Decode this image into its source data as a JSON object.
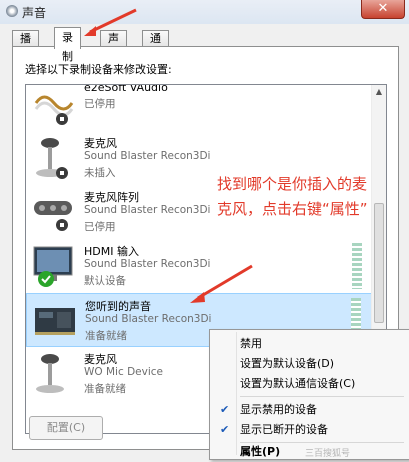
{
  "window": {
    "title": "声音",
    "close_symbol": "✕"
  },
  "tabs": [
    {
      "label": "播放",
      "active": false
    },
    {
      "label": "录制",
      "active": true
    },
    {
      "label": "声音",
      "active": false
    },
    {
      "label": "通信",
      "active": false
    }
  ],
  "panel": {
    "instruction": "选择以下录制设备来修改设置:"
  },
  "devices": [
    {
      "name": "e2eSoft VAudio",
      "model": "",
      "status": "已停用",
      "icon": "cable-icon"
    },
    {
      "name": "麦克风",
      "model": "Sound Blaster Recon3Di",
      "status": "未插入",
      "icon": "microphone-icon"
    },
    {
      "name": "麦克风阵列",
      "model": "Sound Blaster Recon3Di",
      "status": "已停用",
      "icon": "mic-array-icon"
    },
    {
      "name": "HDMI 输入",
      "model": "Sound Blaster Recon3Di",
      "status": "默认设备",
      "icon": "monitor-icon"
    },
    {
      "name": "您听到的声音",
      "model": "Sound Blaster Recon3Di",
      "status": "准备就绪",
      "icon": "soundcard-icon"
    },
    {
      "name": "麦克风",
      "model": "WO Mic Device",
      "status": "准备就绪",
      "icon": "microphone-icon"
    }
  ],
  "buttons": {
    "configure": "配置(C)"
  },
  "annotation": "找到哪个是你插入的麦克风，点击右键“属性”",
  "context_menu": {
    "items": [
      {
        "label": "禁用",
        "checked": false,
        "bold": false
      },
      {
        "label": "设置为默认设备(D)",
        "checked": false,
        "bold": false
      },
      {
        "label": "设置为默认通信设备(C)",
        "checked": false,
        "bold": false
      },
      {
        "label": "显示禁用的设备",
        "checked": true,
        "bold": false
      },
      {
        "label": "显示已断开的设备",
        "checked": true,
        "bold": false
      },
      {
        "label": "属性(P)",
        "checked": false,
        "bold": true
      }
    ],
    "check_symbol": "✔"
  },
  "watermark": "三百搜狐号",
  "colors": {
    "annotation": "#e23a2a",
    "selection": "#cde8ff",
    "default_badge": "#2aa52a"
  }
}
